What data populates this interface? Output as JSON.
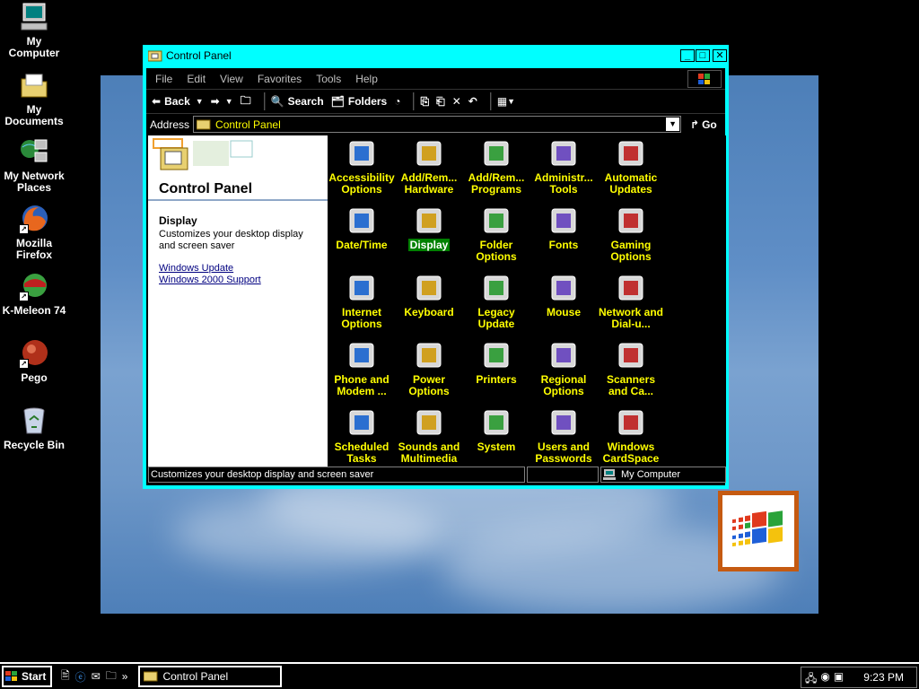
{
  "desktop": {
    "icons": [
      {
        "name": "my-computer-icon",
        "label": "My Computer"
      },
      {
        "name": "my-documents-icon",
        "label": "My Documents"
      },
      {
        "name": "my-network-places-icon",
        "label": "My Network Places"
      },
      {
        "name": "mozilla-firefox-icon",
        "label": "Mozilla Firefox"
      },
      {
        "name": "k-meleon-icon",
        "label": "K-Meleon 74"
      },
      {
        "name": "pego-icon",
        "label": "Pego"
      },
      {
        "name": "recycle-bin-icon",
        "label": "Recycle Bin"
      }
    ]
  },
  "window": {
    "title": "Control Panel",
    "menu": [
      "File",
      "Edit",
      "View",
      "Favorites",
      "Tools",
      "Help"
    ],
    "toolbar": {
      "back": "Back",
      "search": "Search",
      "folders": "Folders"
    },
    "address": {
      "label": "Address",
      "value": "Control Panel",
      "go": "Go"
    },
    "left_pane": {
      "title": "Control Panel",
      "selected_name": "Display",
      "selected_desc": "Customizes your desktop display and screen saver",
      "links": [
        "Windows Update",
        "Windows 2000 Support"
      ]
    },
    "items": [
      "Accessibility Options",
      "Add/Rem... Hardware",
      "Add/Rem... Programs",
      "Administr... Tools",
      "Automatic Updates",
      "Date/Time",
      "Display",
      "Folder Options",
      "Fonts",
      "Gaming Options",
      "Internet Options",
      "Keyboard",
      "Legacy Update",
      "Mouse",
      "Network and Dial-u...",
      "Phone and Modem ...",
      "Power Options",
      "Printers",
      "Regional Options",
      "Scanners and Ca...",
      "Scheduled Tasks",
      "Sounds and Multimedia",
      "System",
      "Users and Passwords",
      "Windows CardSpace"
    ],
    "selected_item": "Display",
    "status": {
      "text": "Customizes your desktop display and screen saver",
      "zone": "My Computer"
    }
  },
  "taskbar": {
    "start": "Start",
    "task": "Control Panel",
    "clock": "9:23 PM"
  },
  "colors": {
    "accent": "#00ffff",
    "item_text": "#ffff00",
    "selection": "#008000",
    "link": "#000080"
  }
}
